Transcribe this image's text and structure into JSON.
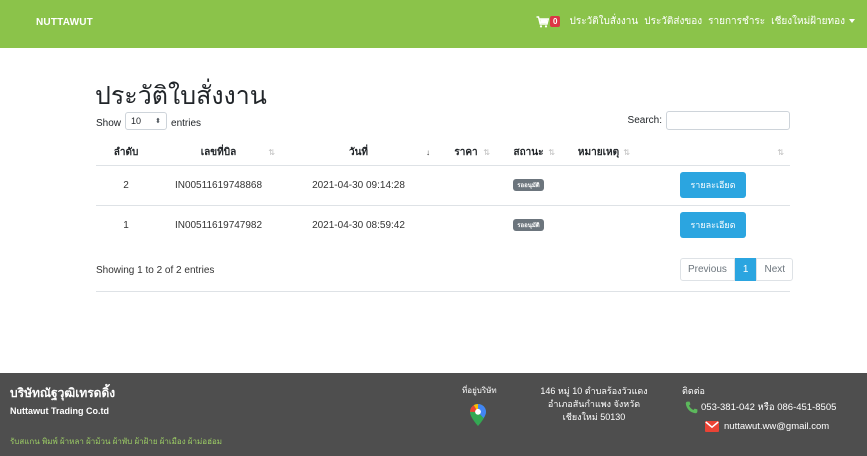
{
  "navbar": {
    "brand": "NUTTAWUT",
    "cart_count": "0",
    "links": [
      "ประวัติใบสั่งงาน",
      "ประวัติส่งของ",
      "รายการชำระ",
      "เชียงใหม่ฝ้ายทอง"
    ]
  },
  "page": {
    "title": "ประวัติใบสั่งงาน"
  },
  "datatable": {
    "show_label": "Show",
    "length_value": "10",
    "entries_label": "entries",
    "search_label": "Search:",
    "search_value": "",
    "columns": [
      "ลำดับ",
      "เลขที่บิล",
      "วันที่",
      "ราคา",
      "สถานะ",
      "หมายเหตุ",
      ""
    ],
    "rows": [
      {
        "index": "2",
        "bill": "IN00511619748868",
        "date": "2021-04-30 09:14:28",
        "price": "",
        "status": "รออนุมัติ",
        "note": "",
        "action": "รายละเอียด"
      },
      {
        "index": "1",
        "bill": "IN00511619747982",
        "date": "2021-04-30 08:59:42",
        "price": "",
        "status": "รออนุมัติ",
        "note": "",
        "action": "รายละเอียด"
      }
    ],
    "info": "Showing 1 to 2 of 2 entries",
    "pagination": {
      "previous": "Previous",
      "current": "1",
      "next": "Next"
    }
  },
  "footer": {
    "company_th": "บริษัทณัฐวุฒิเทรดดิ้ง",
    "company_en": "Nuttawut Trading Co.td",
    "services": "รับสแกน พิมพ์ ผ้าหลา ผ้าม้วน ผ้าพับ ผ้าฝ้าย ผ้าเมือง ผ้าม่อฮ่อม",
    "address_label": "ที่อยู่บริษัท",
    "address_lines": [
      "146 หมู่ 10 ตำบลร้องวัวแดง",
      "อำเภอสันกำแพง จังหวัด",
      "เชียงใหม่ 50130"
    ],
    "contact_label": "ติดต่อ",
    "phone": "053-381-042 หรือ 086-451-8505",
    "email": "nuttawut.ww@gmail.com"
  },
  "colors": {
    "navbar": "#8bc34a",
    "footer": "#4e4e4e",
    "primary": "#2ba5e0",
    "badge": "#6c757d",
    "cart_badge": "#dc3545"
  }
}
